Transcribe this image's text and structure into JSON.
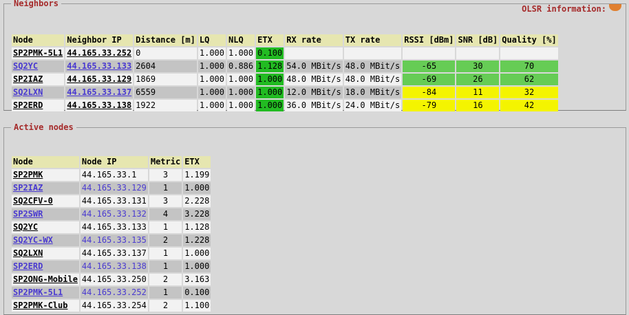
{
  "neighbors": {
    "legend": "Neighbors",
    "olsr_info": "OLSR information:",
    "headers": [
      "Node",
      "Neighbor IP",
      "Distance [m]",
      "LQ",
      "NLQ",
      "ETX",
      "RX rate",
      "TX rate",
      "RSSI [dBm]",
      "SNR [dB]",
      "Quality [%]"
    ],
    "rows": [
      {
        "node": "SP2PMK-5L1",
        "ip": "44.165.33.252",
        "dist": "0",
        "lq": "1.000",
        "nlq": "1.000",
        "etx": "0.100",
        "rx": "",
        "tx": "",
        "rssi": "",
        "snr": "",
        "quality": "",
        "link": false,
        "q": ""
      },
      {
        "node": "SQ2YC",
        "ip": "44.165.33.133",
        "dist": "2604",
        "lq": "1.000",
        "nlq": "0.886",
        "etx": "1.128",
        "rx": "54.0 MBit/s",
        "tx": "48.0 MBit/s",
        "rssi": "-65",
        "snr": "30",
        "quality": "70",
        "link": true,
        "q": "green"
      },
      {
        "node": "SP2IAZ",
        "ip": "44.165.33.129",
        "dist": "1869",
        "lq": "1.000",
        "nlq": "1.000",
        "etx": "1.000",
        "rx": "48.0 MBit/s",
        "tx": "48.0 MBit/s",
        "rssi": "-69",
        "snr": "26",
        "quality": "62",
        "link": false,
        "q": "green"
      },
      {
        "node": "SQ2LXN",
        "ip": "44.165.33.137",
        "dist": "6559",
        "lq": "1.000",
        "nlq": "1.000",
        "etx": "1.000",
        "rx": "12.0 MBit/s",
        "tx": "18.0 MBit/s",
        "rssi": "-84",
        "snr": "11",
        "quality": "32",
        "link": true,
        "q": "yellow"
      },
      {
        "node": "SP2ERD",
        "ip": "44.165.33.138",
        "dist": "1922",
        "lq": "1.000",
        "nlq": "1.000",
        "etx": "1.000",
        "rx": "36.0 MBit/s",
        "tx": "24.0 MBit/s",
        "rssi": "-79",
        "snr": "16",
        "quality": "42",
        "link": false,
        "q": "yellow"
      }
    ]
  },
  "active": {
    "legend": "Active nodes",
    "headers": [
      "Node",
      "Node IP",
      "Metric",
      "ETX"
    ],
    "rows": [
      {
        "node": "SP2PMK",
        "ip": "44.165.33.1",
        "metric": "3",
        "etx": "1.199"
      },
      {
        "node": "SP2IAZ",
        "ip": "44.165.33.129",
        "metric": "1",
        "etx": "1.000"
      },
      {
        "node": "SQ2CFV-0",
        "ip": "44.165.33.131",
        "metric": "3",
        "etx": "2.228"
      },
      {
        "node": "SP2SWR",
        "ip": "44.165.33.132",
        "metric": "4",
        "etx": "3.228"
      },
      {
        "node": "SQ2YC",
        "ip": "44.165.33.133",
        "metric": "1",
        "etx": "1.128"
      },
      {
        "node": "SQ2YC-WX",
        "ip": "44.165.33.135",
        "metric": "2",
        "etx": "1.228"
      },
      {
        "node": "SQ2LXN",
        "ip": "44.165.33.137",
        "metric": "1",
        "etx": "1.000"
      },
      {
        "node": "SP2ERD",
        "ip": "44.165.33.138",
        "metric": "1",
        "etx": "1.000"
      },
      {
        "node": "SP2ONG-Mobile",
        "ip": "44.165.33.250",
        "metric": "2",
        "etx": "3.163"
      },
      {
        "node": "SP2PMK-5L1",
        "ip": "44.165.33.252",
        "metric": "1",
        "etx": "0.100"
      },
      {
        "node": "SP2PMK-Club",
        "ip": "44.165.33.254",
        "metric": "2",
        "etx": "1.100"
      }
    ]
  },
  "colors": {
    "legend": "#a52a2a",
    "header_bg": "#e6e6b0",
    "row_light": "#f2f2f2",
    "row_dark": "#c4c4c4",
    "etx_good": "#22bb22",
    "quality_good": "#66cc55",
    "quality_mid": "#f4f400",
    "link": "#4a3ad0"
  }
}
